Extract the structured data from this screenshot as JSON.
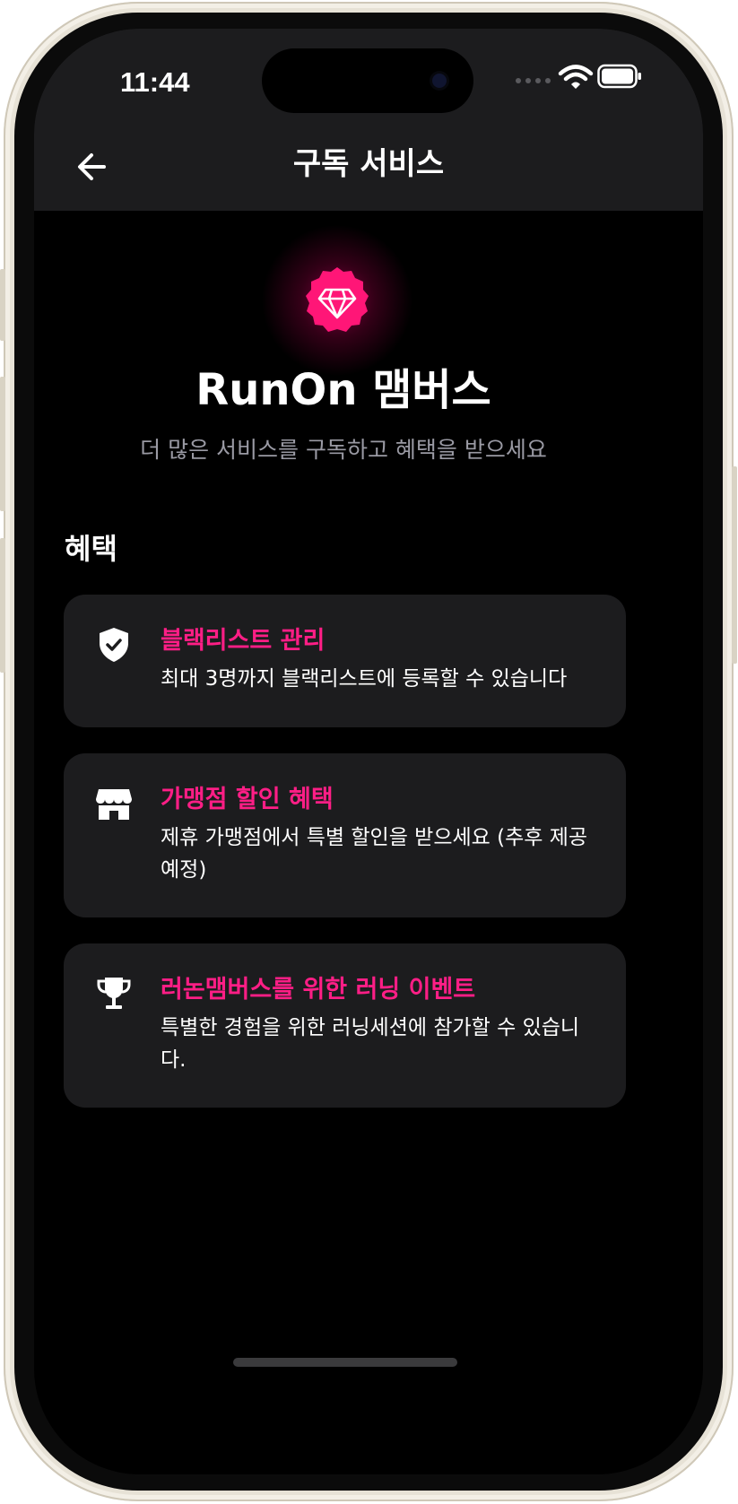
{
  "status_bar": {
    "time": "11:44"
  },
  "header": {
    "title": "구독 서비스"
  },
  "hero": {
    "icon": "diamond-badge-icon",
    "title": "RunOn 맴버스",
    "subtitle": "더 많은 서비스를 구독하고 혜택을 받으세요"
  },
  "benefits": {
    "section_title": "혜택",
    "items": [
      {
        "icon": "shield-check-icon",
        "title": "블랙리스트 관리",
        "description": "최대 3명까지 블랙리스트에 등록할 수 있습니다"
      },
      {
        "icon": "store-icon",
        "title": "가맹점 할인 혜택",
        "description": "제휴 가맹점에서 특별 할인을 받으세요 (추후 제공 예정)"
      },
      {
        "icon": "trophy-icon",
        "title": "러논맴버스를 위한 러닝 이벤트",
        "description": "특별한 경험을 위한 러닝세션에 참가할 수 있습니다."
      }
    ]
  },
  "colors": {
    "accent": "#ff1e86",
    "background": "#000000",
    "card": "#1c1c1e",
    "header": "#1c1c1e"
  }
}
